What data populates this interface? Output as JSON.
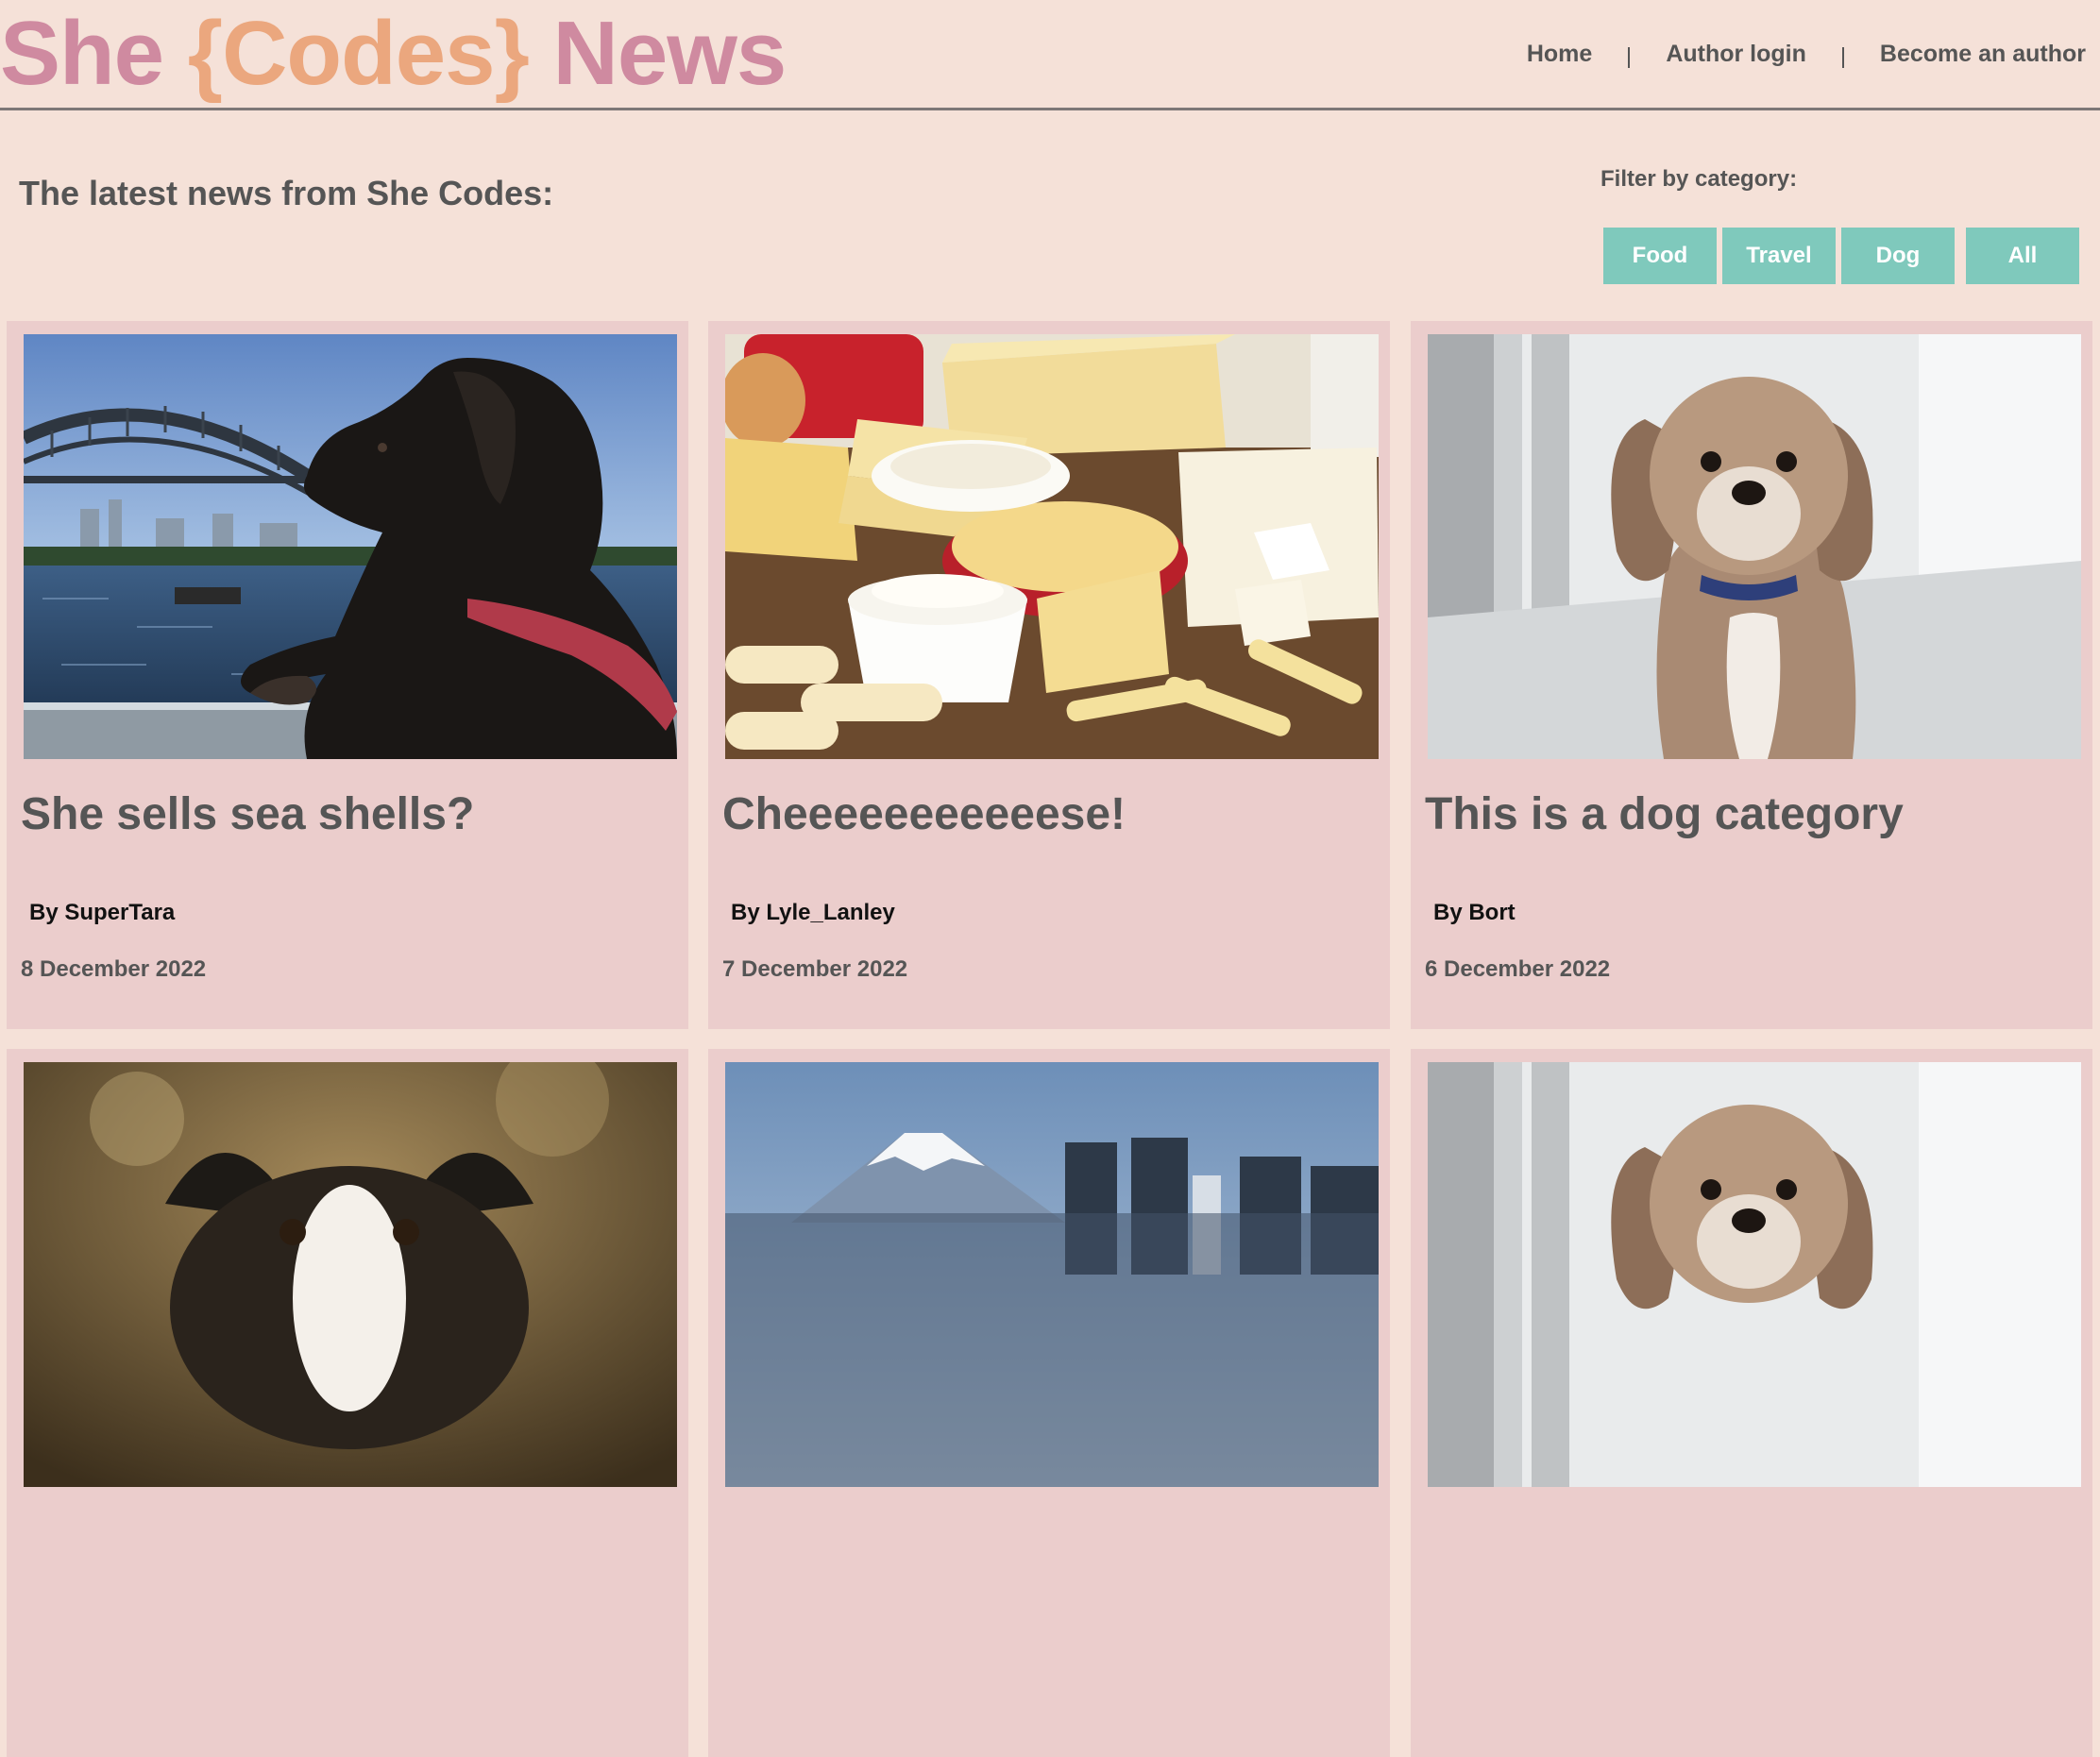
{
  "brand": {
    "part1": "She ",
    "part2": "{Codes}",
    "part3": " News",
    "color_pink": "#cf8aa0",
    "color_orange": "#eba77e"
  },
  "nav": {
    "home": "Home",
    "login": "Author login",
    "become": "Become an author"
  },
  "intro": {
    "title": "The latest news from She Codes:"
  },
  "filter": {
    "label": "Filter by category:",
    "buttons": [
      "Food",
      "Travel",
      "Dog",
      "All"
    ],
    "button_color": "#7fc9bc"
  },
  "articles": [
    {
      "title": "She sells sea shells?",
      "author": "By SuperTara",
      "date": "8 December 2022",
      "image": "dog-harbour-bridge-photo"
    },
    {
      "title": "Cheeeeeeeeeeese!",
      "author": "By Lyle_Lanley",
      "date": "7 December 2022",
      "image": "cheese-platter-photo"
    },
    {
      "title": "This is a dog category",
      "author": "By Bort",
      "date": "6 December 2022",
      "image": "fluffy-dog-photo"
    },
    {
      "image": "border-collie-photo"
    },
    {
      "image": "mount-fuji-city-photo"
    },
    {
      "image": "fluffy-dog-photo"
    }
  ],
  "colors": {
    "page_bg": "#f5e1d8",
    "card_bg": "#ebcdcc",
    "text": "#555555"
  }
}
